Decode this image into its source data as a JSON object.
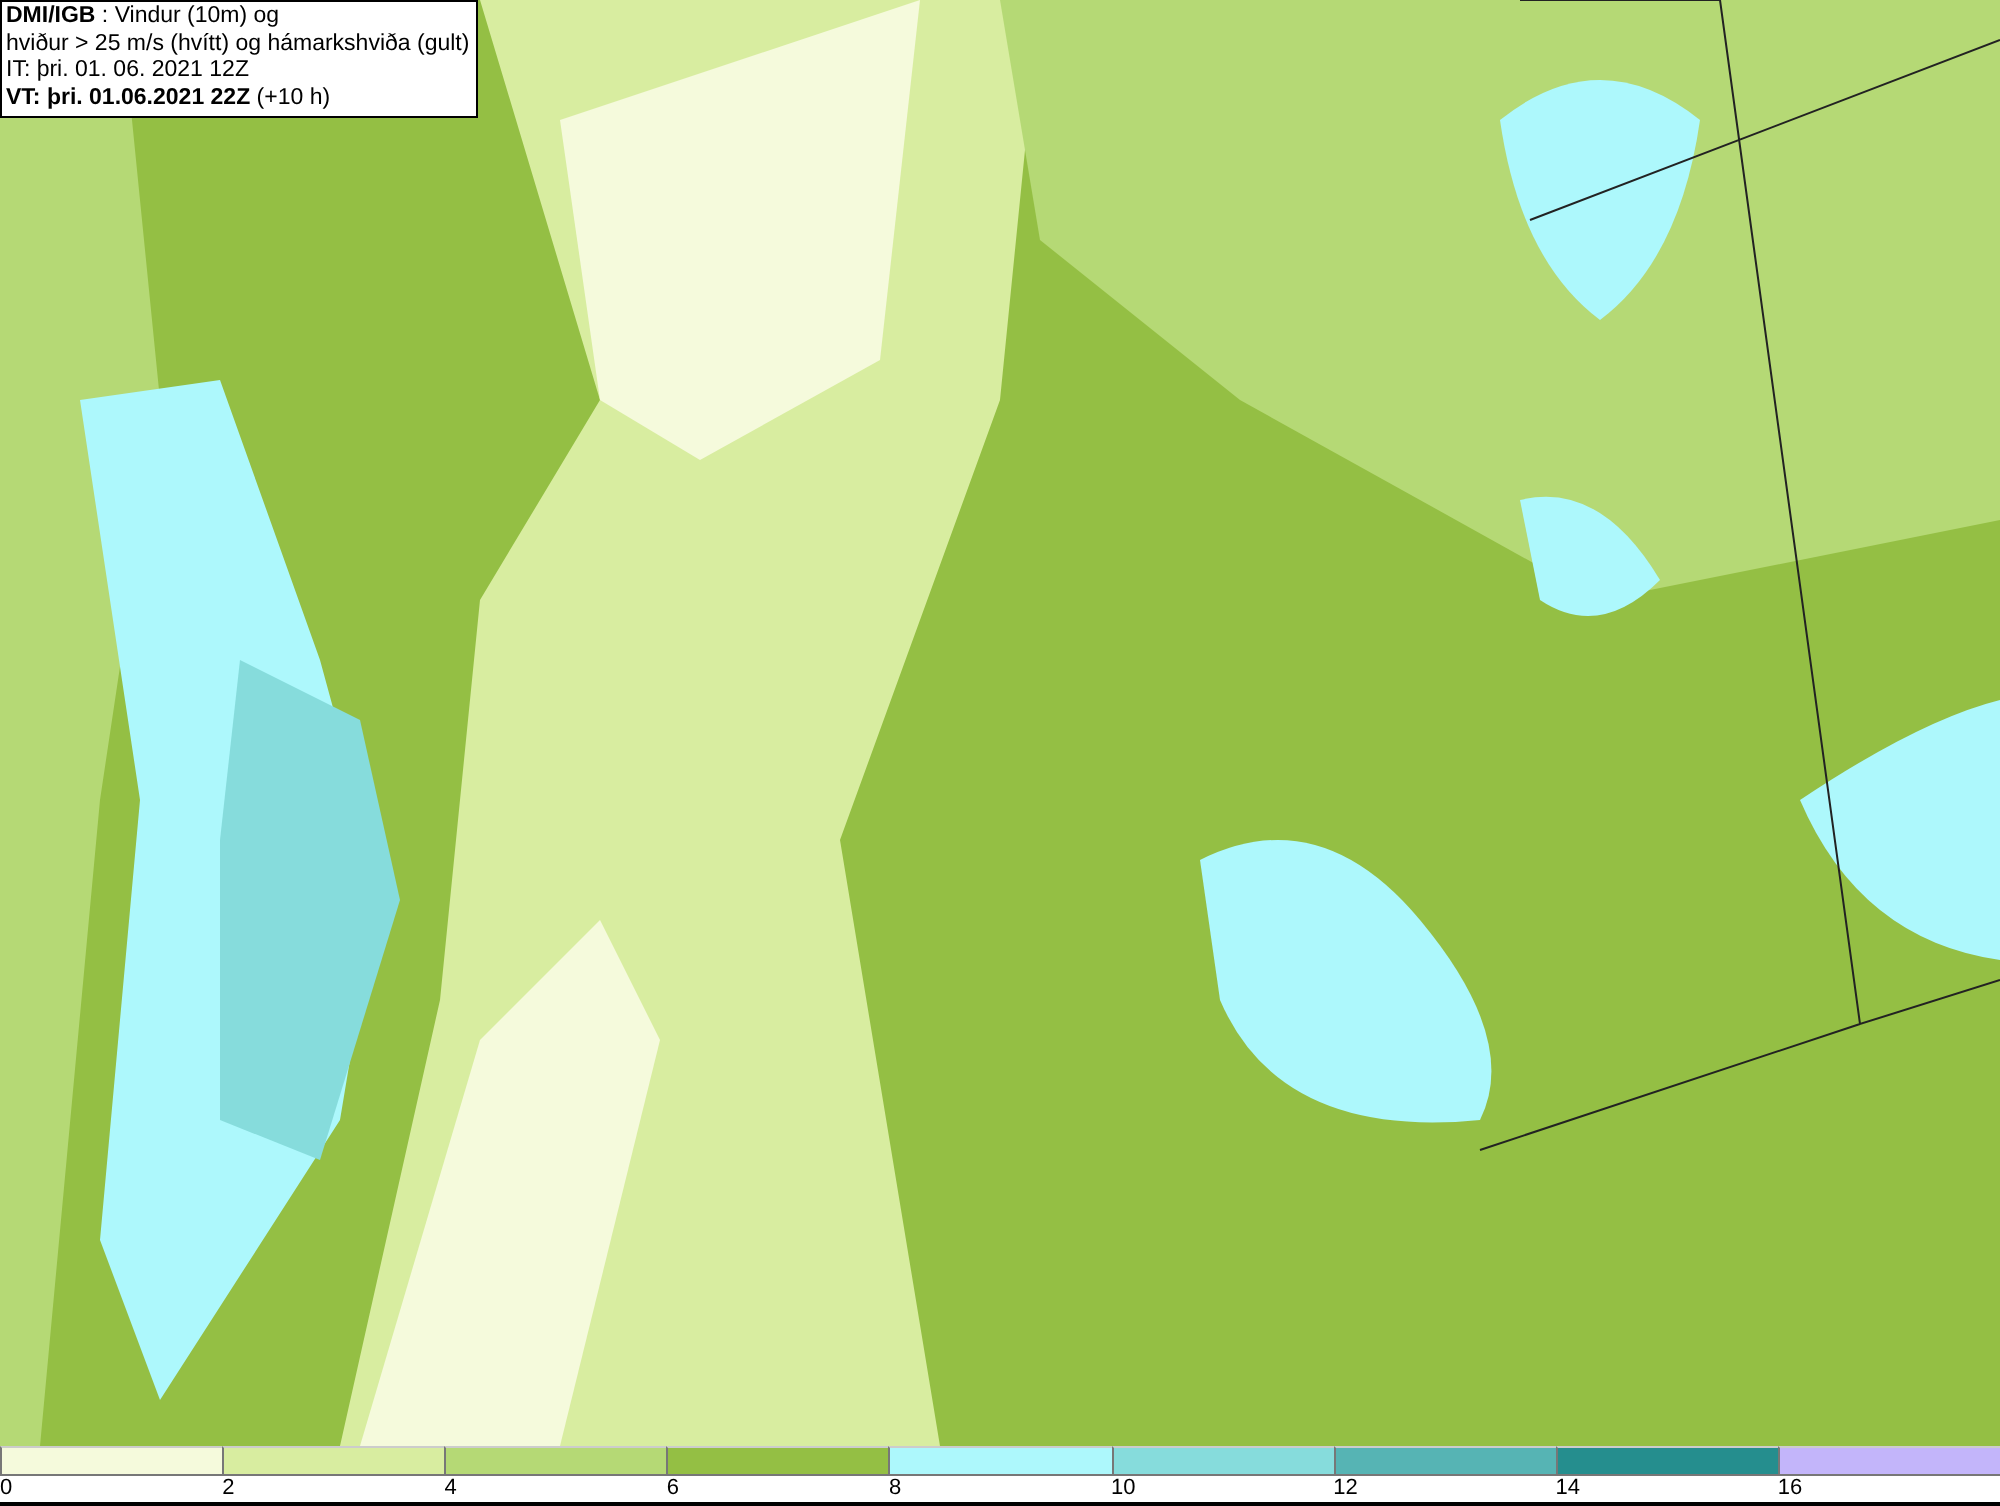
{
  "info_box": {
    "lines": [
      "**DMI/IGB** : Vindur (10m) og",
      "hviður > 25 m/s (hvítt) og hámarkshviða (gult)",
      "IT: þri. 01. 06. 2021 12Z",
      "**VT: þri. 01.06.2021 22Z** (+10 h)"
    ]
  },
  "legend": [
    {
      "label": "0",
      "color": "#f5fadc"
    },
    {
      "label": "2",
      "color": "#d8eda0"
    },
    {
      "label": "4",
      "color": "#b5d975"
    },
    {
      "label": "6",
      "color": "#94bf44"
    },
    {
      "label": "8",
      "color": "#adf8fc"
    },
    {
      "label": "10",
      "color": "#86dcdc"
    },
    {
      "label": "12",
      "color": "#56b4b4"
    },
    {
      "label": "14",
      "color": "#258e8e"
    },
    {
      "label": "16",
      "color": "#c3b5fa"
    }
  ]
}
